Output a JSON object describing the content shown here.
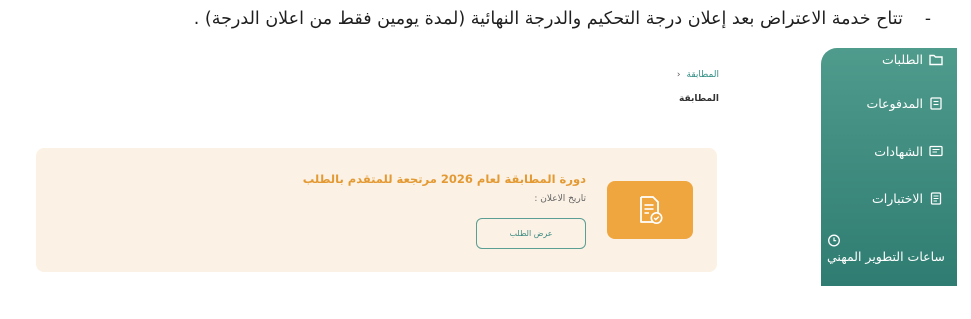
{
  "note": {
    "bullet": "-",
    "text": "تتاح خدمة الاعتراض بعد إعلان درجة التحكيم والدرجة النهائية (لمدة يومين فقط من اعلان الدرجة) ."
  },
  "sidebar": {
    "items": [
      {
        "label": "الطلبات",
        "icon": "folder-icon"
      },
      {
        "label": "المدفوعات",
        "icon": "receipt-icon"
      },
      {
        "label": "الشهادات",
        "icon": "certificate-icon"
      },
      {
        "label": "الاختبارات",
        "icon": "exam-icon"
      },
      {
        "label": "ساعات التطوير المهني",
        "icon": "clock-icon"
      }
    ]
  },
  "breadcrumb": {
    "link": "المطابقة",
    "chevron": "‹"
  },
  "page_title": "المطابقة",
  "card": {
    "title": "دورة المطابقة لعام 2026 مرتجعة للمتقدم بالطلب",
    "date_label": "تاريخ الاعلان :",
    "button_label": "عرض الطلب",
    "icon": "document-check-icon"
  },
  "colors": {
    "sidebar": "#3f8c80",
    "accent_orange": "#f0a63f",
    "card_background": "#fbf1e5",
    "link": "#2f8e84"
  }
}
